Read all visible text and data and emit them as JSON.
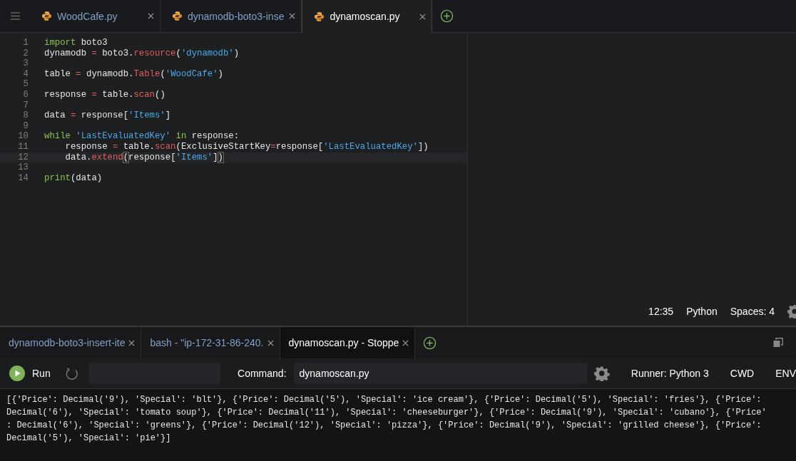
{
  "editor_tabs": [
    {
      "label": "WoodCafe.py",
      "selected": false
    },
    {
      "label": "dynamodb-boto3-inse",
      "selected": false
    },
    {
      "label": "dynamoscan.py",
      "selected": true
    }
  ],
  "code": [
    {
      "number": "1",
      "tokens": [
        {
          "kind": "keyword",
          "text": "import"
        },
        {
          "kind": "plain",
          "text": " boto3"
        }
      ]
    },
    {
      "number": "2",
      "tokens": [
        {
          "kind": "plain",
          "text": "dynamodb "
        },
        {
          "kind": "operator",
          "text": "="
        },
        {
          "kind": "plain",
          "text": " boto3."
        },
        {
          "kind": "call",
          "text": "resource"
        },
        {
          "kind": "plain",
          "text": "("
        },
        {
          "kind": "string",
          "text": "'dynamodb'"
        },
        {
          "kind": "plain",
          "text": ")"
        }
      ]
    },
    {
      "number": "3"
    },
    {
      "number": "4",
      "tokens": [
        {
          "kind": "plain",
          "text": "table "
        },
        {
          "kind": "operator",
          "text": "="
        },
        {
          "kind": "plain",
          "text": " dynamodb."
        },
        {
          "kind": "call",
          "text": "Table"
        },
        {
          "kind": "plain",
          "text": "("
        },
        {
          "kind": "string",
          "text": "'WoodCafe'"
        },
        {
          "kind": "plain",
          "text": ")"
        }
      ]
    },
    {
      "number": "5"
    },
    {
      "number": "6",
      "tokens": [
        {
          "kind": "plain",
          "text": "response "
        },
        {
          "kind": "operator",
          "text": "="
        },
        {
          "kind": "plain",
          "text": " table."
        },
        {
          "kind": "call",
          "text": "scan"
        },
        {
          "kind": "plain",
          "text": "()"
        }
      ]
    },
    {
      "number": "7"
    },
    {
      "number": "8",
      "tokens": [
        {
          "kind": "plain",
          "text": "data "
        },
        {
          "kind": "operator",
          "text": "="
        },
        {
          "kind": "plain",
          "text": " response["
        },
        {
          "kind": "string",
          "text": "'Items'"
        },
        {
          "kind": "plain",
          "text": "]"
        }
      ]
    },
    {
      "number": "9"
    },
    {
      "number": "10",
      "tokens": [
        {
          "kind": "keyword",
          "text": "while"
        },
        {
          "kind": "string",
          "text": " 'LastEvaluatedKey'"
        },
        {
          "kind": "keyword",
          "text": " in"
        },
        {
          "kind": "plain",
          "text": " response:"
        }
      ]
    },
    {
      "number": "11",
      "tokens": [
        {
          "kind": "plain",
          "text": "    response "
        },
        {
          "kind": "operator",
          "text": "="
        },
        {
          "kind": "plain",
          "text": " table."
        },
        {
          "kind": "call",
          "text": "scan"
        },
        {
          "kind": "plain",
          "text": "(ExclusiveStartKey"
        },
        {
          "kind": "operator",
          "text": "="
        },
        {
          "kind": "plain",
          "text": "response["
        },
        {
          "kind": "string",
          "text": "'LastEvaluatedKey'"
        },
        {
          "kind": "plain",
          "text": "])"
        }
      ]
    },
    {
      "number": "12",
      "current": true,
      "tokens": [
        {
          "kind": "plain",
          "text": "    data."
        },
        {
          "kind": "call",
          "text": "extend"
        },
        {
          "kind": "bracket",
          "text": "("
        },
        {
          "kind": "plain",
          "text": "response["
        },
        {
          "kind": "string",
          "text": "'Items'"
        },
        {
          "kind": "plain",
          "text": "]"
        },
        {
          "kind": "bracket",
          "text": ")"
        }
      ]
    },
    {
      "number": "13"
    },
    {
      "number": "14",
      "tokens": [
        {
          "kind": "keyword",
          "text": "print"
        },
        {
          "kind": "plain",
          "text": "(data)"
        }
      ]
    }
  ],
  "status_bar": {
    "position": "12:35",
    "language": "Python",
    "indent": "Spaces: 4"
  },
  "console_tabs": [
    {
      "label": "dynamodb-boto3-insert-ite",
      "selected": false
    },
    {
      "label": "bash - \"ip-172-31-86-240.",
      "selected": false
    },
    {
      "label": "dynamoscan.py - Stoppe",
      "selected": true
    }
  ],
  "toolbar": {
    "run": "Run",
    "command_label": "Command:",
    "command": "dynamoscan.py",
    "runner": "Runner: Python 3",
    "cwd": "CWD",
    "env": "ENV"
  },
  "output": [
    "[{'Price': Decimal('9'), 'Special': 'blt'}, {'Price': Decimal('5'), 'Special': 'ice cream'}, {'Price': Decimal('5'), 'Special': 'fries'}, {'Price':",
    "Decimal('6'), 'Special': 'tomato soup'}, {'Price': Decimal('11'), 'Special': 'cheeseburger'}, {'Price': Decimal('9'), 'Special': 'cubano'}, {'Price'",
    ": Decimal('6'), 'Special': 'greens'}, {'Price': Decimal('12'), 'Special': 'pizza'}, {'Price': Decimal('9'), 'Special': 'grilled cheese'}, {'Price':",
    "Decimal('5'), 'Special': 'pie'}]"
  ]
}
